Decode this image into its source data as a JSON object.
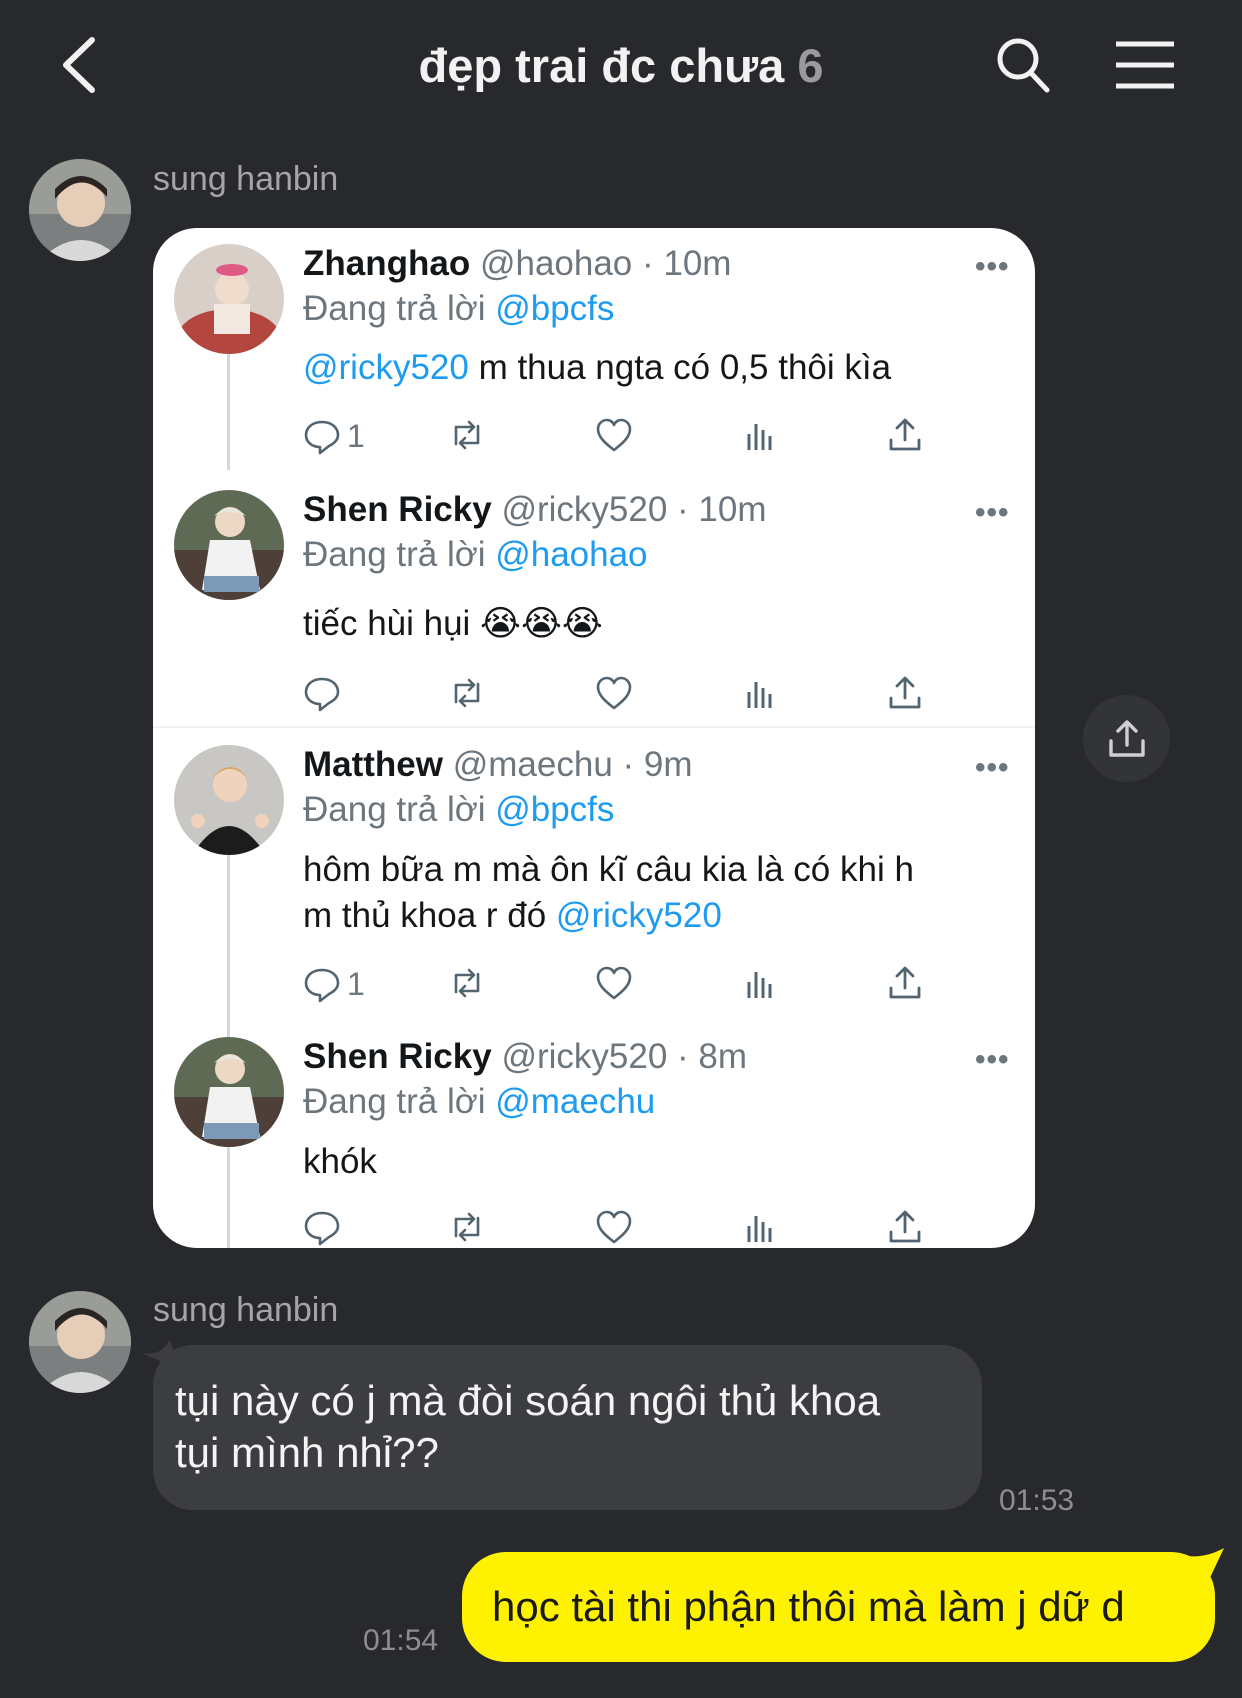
{
  "header": {
    "title": "đẹp trai đc chưa",
    "member_count": "6"
  },
  "messages": {
    "first": {
      "sender": "sung hanbin"
    },
    "second": {
      "sender": "sung hanbin",
      "text_line1": "tụi này có j mà đòi soán ngôi thủ khoa",
      "text_line2": "tụi mình nhỉ??",
      "time": "01:53"
    },
    "mine": {
      "text": "học tài thi phận thôi mà làm j dữ d",
      "time": "01:54"
    }
  },
  "tweets": [
    {
      "name": "Zhanghao",
      "meta": "@haohao · 10m",
      "reply_prefix": "Đang trả lời",
      "reply_to": "@bpcfs",
      "mention": "@ricky520",
      "text": " m thua ngta có 0,5 thôi kìa",
      "reply_count": "1",
      "dots": "•••"
    },
    {
      "name": "Shen Ricky",
      "meta": "@ricky520 · 10m",
      "reply_prefix": "Đang trả lời",
      "reply_to": "@haohao",
      "text": "tiếc hùi hụi 😭😭😭",
      "dots": "•••"
    },
    {
      "name": "Matthew",
      "meta": "@maechu · 9m",
      "reply_prefix": "Đang trả lời",
      "reply_to": "@bpcfs",
      "text_line1": "hôm bữa m mà ôn kĩ câu kia là có khi h",
      "text_line2": "m thủ khoa r đó ",
      "mention": "@ricky520",
      "reply_count": "1",
      "dots": "•••"
    },
    {
      "name": "Shen Ricky",
      "meta": "@ricky520 · 8m",
      "reply_prefix": "Đang trả lời",
      "reply_to": "@maechu",
      "text": "khók",
      "dots": "•••"
    }
  ],
  "colors": {
    "background": "#28292c",
    "incoming_bubble": "#3c3d41",
    "outgoing_bubble": "#fff200",
    "mention": "#1d9bf0"
  },
  "icons": [
    "back-icon",
    "search-icon",
    "menu-icon",
    "share-icon",
    "reply-icon",
    "retweet-icon",
    "like-icon",
    "stats-icon"
  ]
}
